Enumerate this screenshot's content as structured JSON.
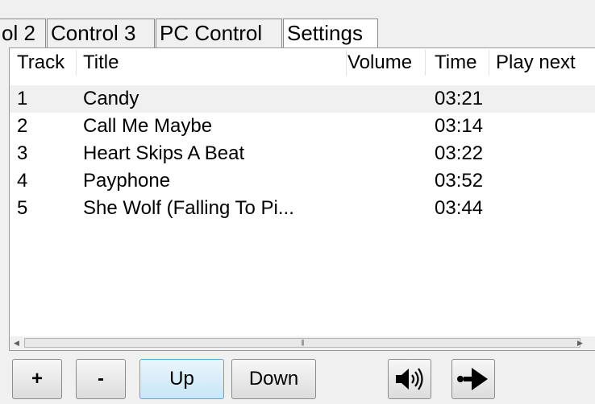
{
  "tabs": [
    {
      "label": "ol 2",
      "selected": false
    },
    {
      "label": "Control 3",
      "selected": false
    },
    {
      "label": "PC Control",
      "selected": false
    },
    {
      "label": "Settings",
      "selected": true
    }
  ],
  "playlist": {
    "columns": [
      "Track",
      "Title",
      "Volume",
      "Time",
      "Play next"
    ],
    "rows": [
      {
        "track": "1",
        "title": "Candy",
        "volume": "",
        "time": "03:21",
        "play_next": ""
      },
      {
        "track": "2",
        "title": "Call Me Maybe",
        "volume": "",
        "time": "03:14",
        "play_next": ""
      },
      {
        "track": "3",
        "title": "Heart Skips A Beat",
        "volume": "",
        "time": "03:22",
        "play_next": ""
      },
      {
        "track": "4",
        "title": "Payphone",
        "volume": "",
        "time": "03:52",
        "play_next": ""
      },
      {
        "track": "5",
        "title": "She Wolf (Falling To Pi...",
        "volume": "",
        "time": "03:44",
        "play_next": ""
      }
    ],
    "selected_row": 0
  },
  "buttons": {
    "add": "+",
    "remove": "-",
    "up": "Up",
    "down": "Down",
    "volume_icon": "speaker-icon",
    "play_next_icon": "play-next-icon"
  }
}
